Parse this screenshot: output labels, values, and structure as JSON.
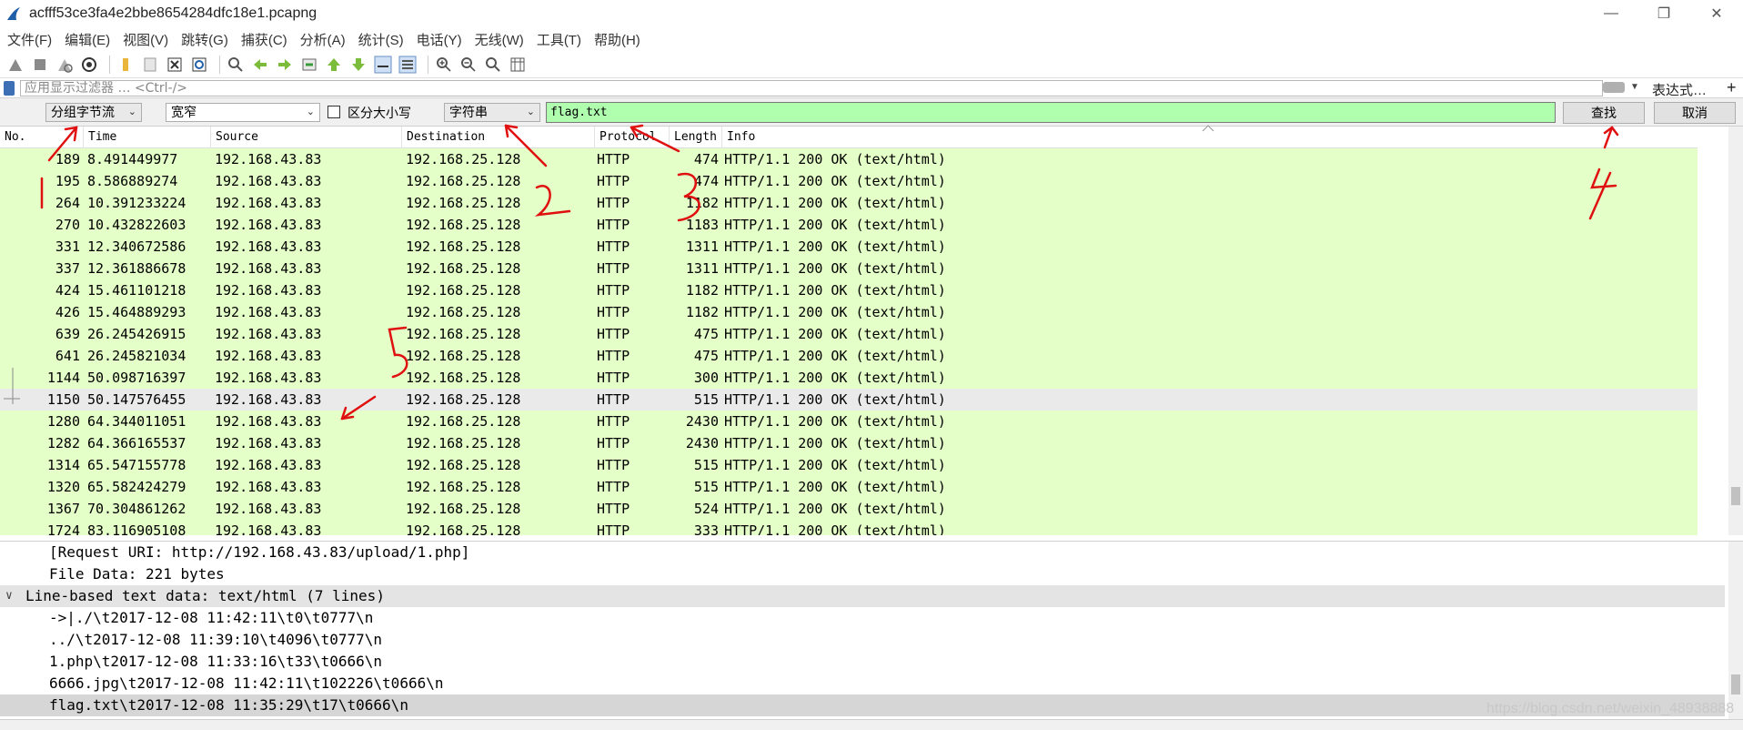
{
  "window": {
    "title": "acfff53ce3fa4e2bbe8654284dfc18e1.pcapng",
    "controls": [
      "—",
      "❐",
      "✕"
    ]
  },
  "menu": [
    "文件(F)",
    "编辑(E)",
    "视图(V)",
    "跳转(G)",
    "捕获(C)",
    "分析(A)",
    "统计(S)",
    "电话(Y)",
    "无线(W)",
    "工具(T)",
    "帮助(H)"
  ],
  "display_filter": {
    "placeholder": "应用显示过滤器 … <Ctrl-/>",
    "expression_label": "表达式…",
    "add_label": "+"
  },
  "find_bar": {
    "search_in": "分组字节流",
    "char_width": "宽窄",
    "case_sensitive_label": "区分大小写",
    "search_type": "字符串",
    "search_value": "flag.txt",
    "find_button": "查找",
    "cancel_button": "取消"
  },
  "packet_list": {
    "columns": [
      "No.",
      "Time",
      "Source",
      "Destination",
      "Protocol",
      "Length",
      "Info"
    ],
    "rows": [
      {
        "no": "189",
        "time": "8.491449977",
        "src": "192.168.43.83",
        "dst": "192.168.25.128",
        "proto": "HTTP",
        "len": "474",
        "info": "HTTP/1.1 200 OK  (text/html)"
      },
      {
        "no": "195",
        "time": "8.586889274",
        "src": "192.168.43.83",
        "dst": "192.168.25.128",
        "proto": "HTTP",
        "len": "474",
        "info": "HTTP/1.1 200 OK  (text/html)"
      },
      {
        "no": "264",
        "time": "10.391233224",
        "src": "192.168.43.83",
        "dst": "192.168.25.128",
        "proto": "HTTP",
        "len": "1182",
        "info": "HTTP/1.1 200 OK  (text/html)"
      },
      {
        "no": "270",
        "time": "10.432822603",
        "src": "192.168.43.83",
        "dst": "192.168.25.128",
        "proto": "HTTP",
        "len": "1183",
        "info": "HTTP/1.1 200 OK  (text/html)"
      },
      {
        "no": "331",
        "time": "12.340672586",
        "src": "192.168.43.83",
        "dst": "192.168.25.128",
        "proto": "HTTP",
        "len": "1311",
        "info": "HTTP/1.1 200 OK  (text/html)"
      },
      {
        "no": "337",
        "time": "12.361886678",
        "src": "192.168.43.83",
        "dst": "192.168.25.128",
        "proto": "HTTP",
        "len": "1311",
        "info": "HTTP/1.1 200 OK  (text/html)"
      },
      {
        "no": "424",
        "time": "15.461101218",
        "src": "192.168.43.83",
        "dst": "192.168.25.128",
        "proto": "HTTP",
        "len": "1182",
        "info": "HTTP/1.1 200 OK  (text/html)"
      },
      {
        "no": "426",
        "time": "15.464889293",
        "src": "192.168.43.83",
        "dst": "192.168.25.128",
        "proto": "HTTP",
        "len": "1182",
        "info": "HTTP/1.1 200 OK  (text/html)"
      },
      {
        "no": "639",
        "time": "26.245426915",
        "src": "192.168.43.83",
        "dst": "192.168.25.128",
        "proto": "HTTP",
        "len": "475",
        "info": "HTTP/1.1 200 OK  (text/html)"
      },
      {
        "no": "641",
        "time": "26.245821034",
        "src": "192.168.43.83",
        "dst": "192.168.25.128",
        "proto": "HTTP",
        "len": "475",
        "info": "HTTP/1.1 200 OK  (text/html)"
      },
      {
        "no": "1144",
        "time": "50.098716397",
        "src": "192.168.43.83",
        "dst": "192.168.25.128",
        "proto": "HTTP",
        "len": "300",
        "info": "HTTP/1.1 200 OK  (text/html)"
      },
      {
        "no": "1150",
        "time": "50.147576455",
        "src": "192.168.43.83",
        "dst": "192.168.25.128",
        "proto": "HTTP",
        "len": "515",
        "info": "HTTP/1.1 200 OK  (text/html)",
        "selected": true
      },
      {
        "no": "1280",
        "time": "64.344011051",
        "src": "192.168.43.83",
        "dst": "192.168.25.128",
        "proto": "HTTP",
        "len": "2430",
        "info": "HTTP/1.1 200 OK  (text/html)"
      },
      {
        "no": "1282",
        "time": "64.366165537",
        "src": "192.168.43.83",
        "dst": "192.168.25.128",
        "proto": "HTTP",
        "len": "2430",
        "info": "HTTP/1.1 200 OK  (text/html)"
      },
      {
        "no": "1314",
        "time": "65.547155778",
        "src": "192.168.43.83",
        "dst": "192.168.25.128",
        "proto": "HTTP",
        "len": "515",
        "info": "HTTP/1.1 200 OK  (text/html)"
      },
      {
        "no": "1320",
        "time": "65.582424279",
        "src": "192.168.43.83",
        "dst": "192.168.25.128",
        "proto": "HTTP",
        "len": "515",
        "info": "HTTP/1.1 200 OK  (text/html)"
      },
      {
        "no": "1367",
        "time": "70.304861262",
        "src": "192.168.43.83",
        "dst": "192.168.25.128",
        "proto": "HTTP",
        "len": "524",
        "info": "HTTP/1.1 200 OK  (text/html)"
      },
      {
        "no": "1724",
        "time": "83.116905108",
        "src": "192.168.43.83",
        "dst": "192.168.25.128",
        "proto": "HTTP",
        "len": "333",
        "info": "HTTP/1.1 200 OK  (text/html)"
      }
    ]
  },
  "details": [
    {
      "text": "[Request URI: http://192.168.43.83/upload/1.php]",
      "indent": 1
    },
    {
      "text": "File Data: 221 bytes",
      "indent": 1
    },
    {
      "text": "Line-based text data: text/html (7 lines)",
      "indent": 0,
      "toggle": "∨",
      "hl": true
    },
    {
      "text": "->|./\\t2017-12-08 11:42:11\\t0\\t0777\\n",
      "indent": 1
    },
    {
      "text": "../\\t2017-12-08 11:39:10\\t4096\\t0777\\n",
      "indent": 1
    },
    {
      "text": "1.php\\t2017-12-08 11:33:16\\t33\\t0666\\n",
      "indent": 1
    },
    {
      "text": "6666.jpg\\t2017-12-08 11:42:11\\t102226\\t0666\\n",
      "indent": 1
    },
    {
      "text": "flag.txt\\t2017-12-08 11:35:29\\t17\\t0666\\n",
      "indent": 1,
      "selected": true
    }
  ],
  "watermark": "https://blog.csdn.net/weixin_48938888",
  "annotations": [
    "1",
    "2",
    "3",
    "4",
    "5"
  ],
  "colors": {
    "row_green": "#e4ffc7",
    "search_green": "#afffaf",
    "arrow_red": "#e01010"
  }
}
